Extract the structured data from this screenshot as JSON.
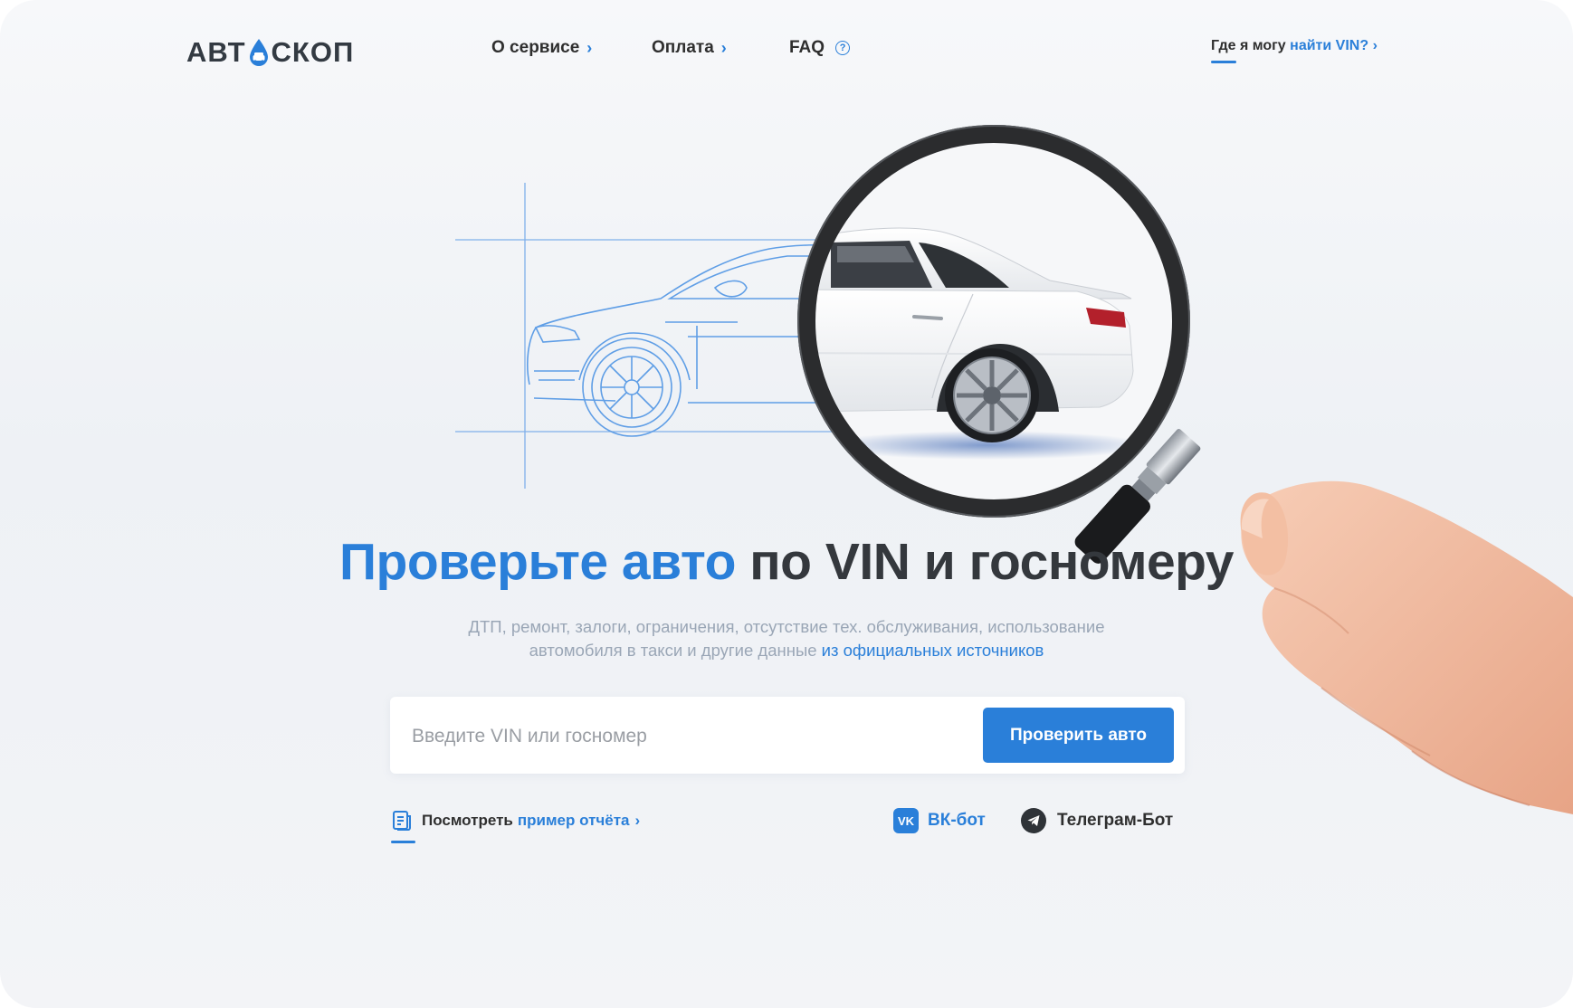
{
  "header": {
    "logo_text_left": "АВТ",
    "logo_text_right": "СКОП",
    "nav": [
      {
        "label": "О сервисе",
        "chevron": "›"
      },
      {
        "label": "Оплата",
        "chevron": "›"
      },
      {
        "label": "FAQ",
        "icon_glyph": "?"
      }
    ],
    "vin_help": {
      "prefix": "Где я могу",
      "link": "найти VIN?",
      "chevron": "›"
    }
  },
  "hero": {
    "headline_accent": "Проверьте авто",
    "headline_rest": "по VIN и госномеру",
    "subtitle_line1": "ДТП, ремонт, залоги, ограничения, отсутствие тех. обслуживания, использование",
    "subtitle_line2": "автомобиля в такси и другие данные",
    "subtitle_link": "из официальных источников"
  },
  "search": {
    "placeholder": "Введите VIN или госномер",
    "value": "",
    "button_label": "Проверить авто"
  },
  "links": {
    "sample_prefix": "Посмотреть",
    "sample_link": "пример отчёта",
    "sample_chevron": "›",
    "vk_icon_text": "VK",
    "vk_label": "ВК-бот",
    "tg_label": "Телеграм-Бот"
  },
  "colors": {
    "accent": "#2a7fd9",
    "text": "#34383d",
    "muted": "#9aa6b6",
    "background": "#f3f4f7"
  },
  "icons": [
    "logo-drop-icon",
    "chevron-right-icon",
    "help-circle-icon",
    "document-icon",
    "vk-icon",
    "telegram-icon",
    "magnifier-illustration",
    "car-illustration",
    "hand-illustration"
  ]
}
